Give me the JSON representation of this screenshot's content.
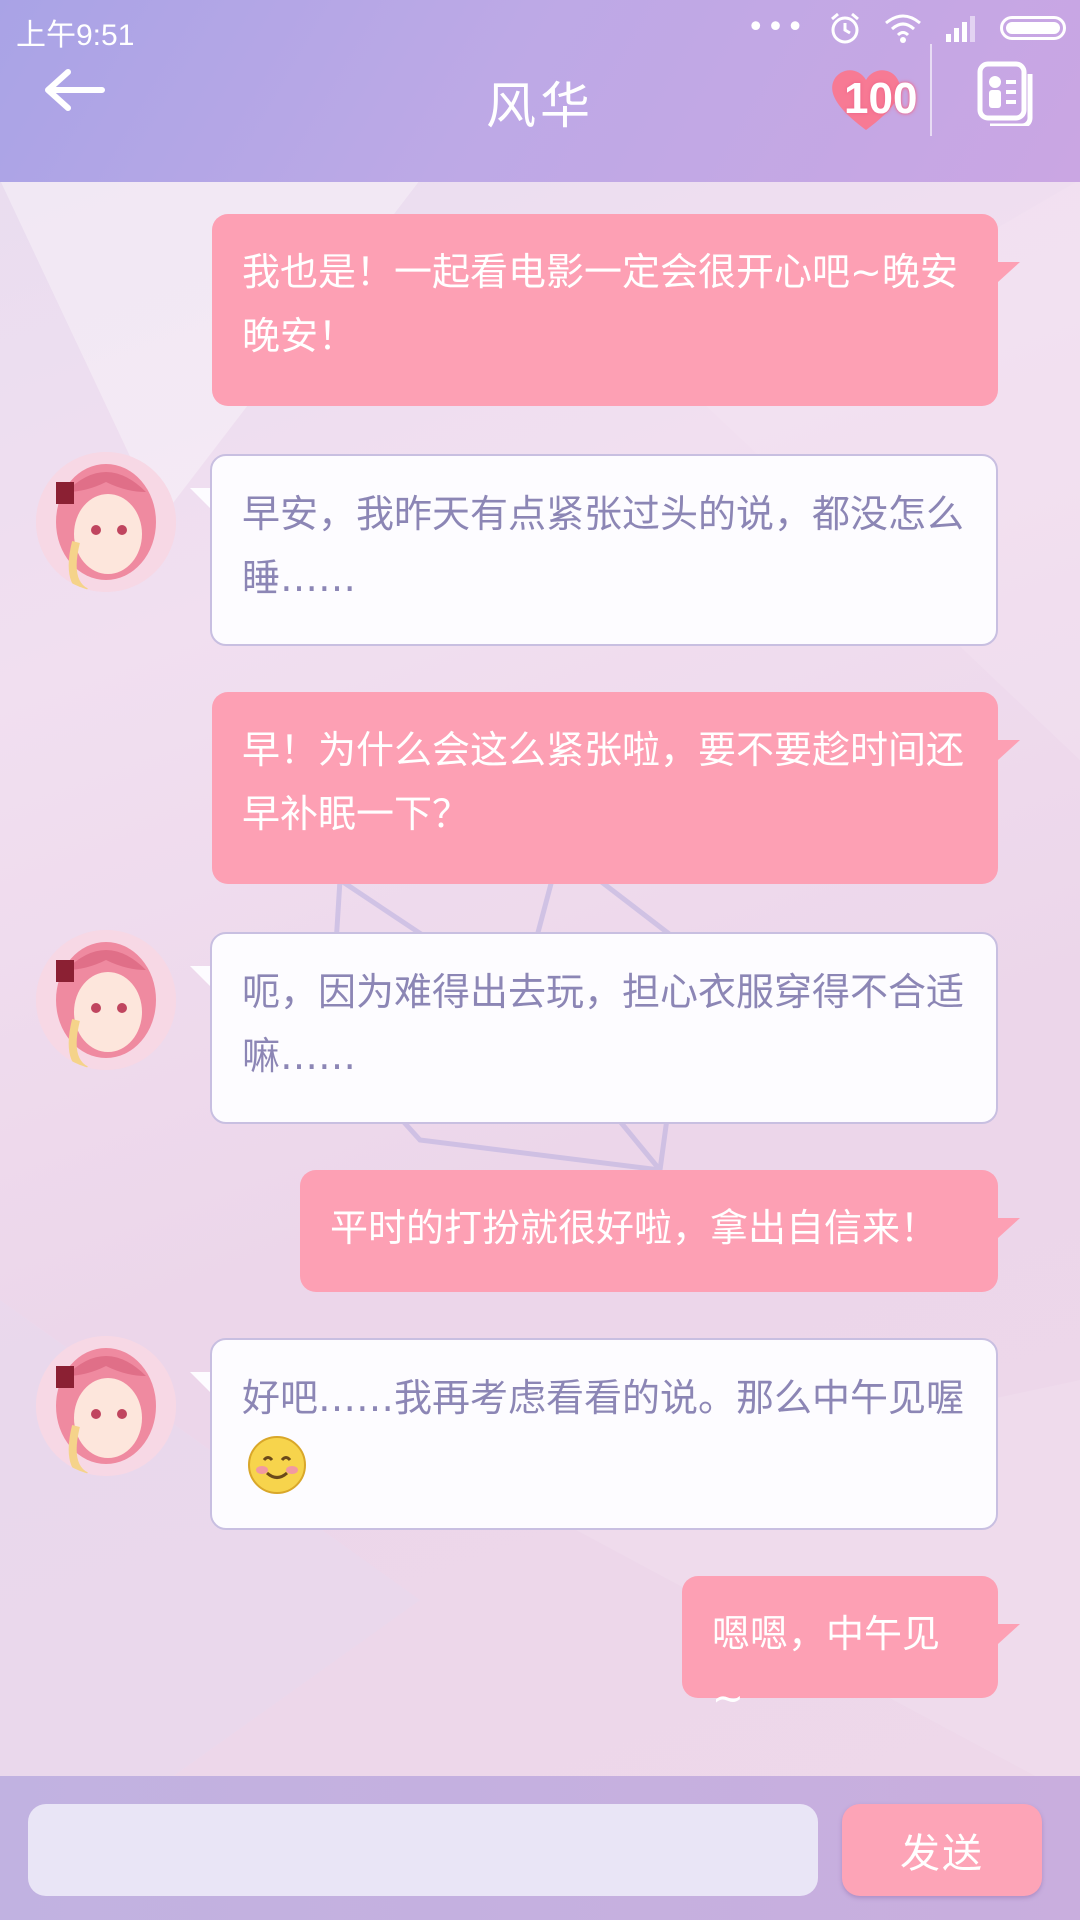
{
  "status_bar": {
    "time": "上午9:51"
  },
  "header": {
    "title": "风华",
    "affinity_value": "100"
  },
  "messages": [
    {
      "direction": "out",
      "text": "我也是！一起看电影一定会很开心吧~晚安晚安！"
    },
    {
      "direction": "in",
      "text": "早安，我昨天有点紧张过头的说，都没怎么睡……"
    },
    {
      "direction": "out",
      "text": "早！为什么会这么紧张啦，要不要趁时间还早补眠一下？"
    },
    {
      "direction": "in",
      "text": "呃，因为难得出去玩，担心衣服穿得不合适嘛……"
    },
    {
      "direction": "out",
      "text": "平时的打扮就很好啦，拿出自信来！"
    },
    {
      "direction": "in",
      "text": "好吧……我再考虑看看的说。那么中午见喔",
      "emoji": "smiling-face-icon"
    },
    {
      "direction": "out",
      "text": "嗯嗯，中午见~"
    }
  ],
  "composer": {
    "input_value": "",
    "send_label": "发送"
  },
  "colors": {
    "outgoing_bubble": "#fda0b4",
    "incoming_text": "#8c86b5",
    "header": "#bda9e6"
  }
}
